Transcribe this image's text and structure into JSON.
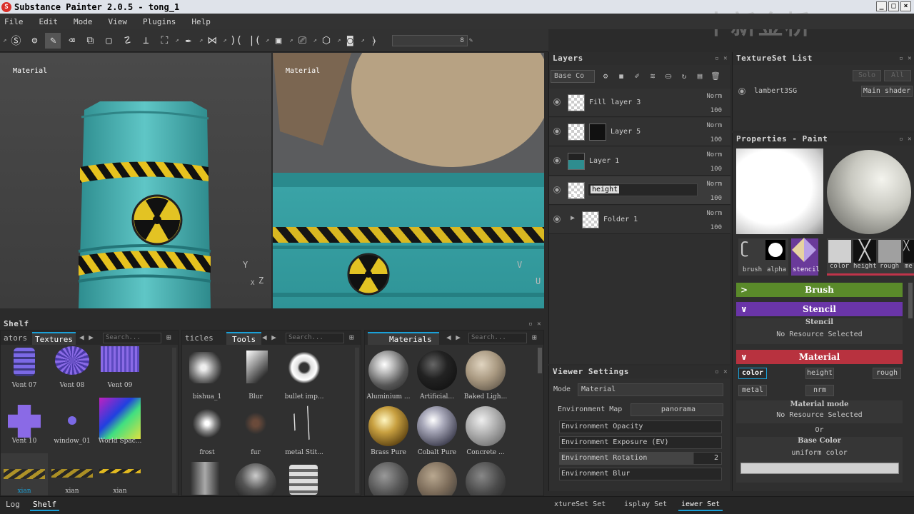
{
  "window": {
    "title": "Substance Painter 2.0.5 - tong_1",
    "app_icon": "S"
  },
  "menu": [
    "File",
    "Edit",
    "Mode",
    "View",
    "Plugins",
    "Help"
  ],
  "watermark": "中新金桥",
  "toolbar": {
    "size_value": "8"
  },
  "viewport_3d": {
    "label": "Material",
    "axis_y": "Y",
    "axis_z": "Z",
    "axis_x": "X"
  },
  "viewport_2d": {
    "label": "Material",
    "axis_v": "V",
    "axis_u": "U"
  },
  "layers": {
    "title": "Layers",
    "blend_mode": "Base Co",
    "items": [
      {
        "name": "Fill layer 3",
        "mode": "Norm",
        "opacity": "100"
      },
      {
        "name": "Layer 5",
        "mode": "Norm",
        "opacity": "100"
      },
      {
        "name": "Layer 1",
        "mode": "Norm",
        "opacity": "100"
      },
      {
        "name": "height",
        "mode": "Norm",
        "opacity": "100"
      },
      {
        "name": "Folder 1",
        "mode": "Norm",
        "opacity": "100"
      }
    ]
  },
  "viewer_settings": {
    "title": "Viewer Settings",
    "mode_label": "Mode",
    "mode_value": "Material",
    "env_map_label": "Environment Map",
    "env_map_value": "panorama",
    "env_opacity": "Environment Opacity",
    "env_exposure": "Environment Exposure (EV)",
    "env_rotation": "Environment Rotation",
    "env_rotation_value": "2",
    "env_blur": "Environment Blur"
  },
  "textureset": {
    "title": "TextureSet List",
    "solo": "Solo",
    "all": "All",
    "item_name": "lambert3SG",
    "shader": "Main shader"
  },
  "properties": {
    "title": "Properties - Paint",
    "brush_slots": [
      "brush",
      "alpha",
      "stencil"
    ],
    "mat_slots": [
      "color",
      "height",
      "rough",
      "me"
    ],
    "brush_section": "Brush",
    "stencil_section": "Stencil",
    "stencil_title": "Stencil",
    "stencil_res": "No Resource Selected",
    "material_section": "Material",
    "channels": [
      "color",
      "height",
      "rough",
      "metal",
      "nrm"
    ],
    "material_mode": "Material mode",
    "material_res": "No Resource Selected",
    "or": "Or",
    "base_color": "Base Color",
    "uniform_color": "uniform color"
  },
  "shelf": {
    "title": "Shelf",
    "panel1": {
      "tab_prev": "ators",
      "tab_active": "Textures",
      "search": "Search...",
      "items": [
        "Vent 07",
        "Vent 08",
        "Vent 09",
        "Vent 10",
        "window_01",
        "World Spac...",
        "xian",
        "xian",
        "xian"
      ]
    },
    "panel2": {
      "tab_prev": "ticles",
      "tab_active": "Tools",
      "search": "Search...",
      "items": [
        "bishua_1",
        "Blur",
        "bullet imp...",
        "frost",
        "fur",
        "metal Stit..."
      ]
    },
    "panel3": {
      "tab_active": "Materials",
      "search": "Search...",
      "items": [
        "Aluminium ...",
        "Artificial...",
        "Baked Ligh...",
        "Brass Pure",
        "Cobalt Pure",
        "Concrete ..."
      ]
    }
  },
  "bottom": {
    "left_tabs": [
      "Log",
      "Shelf"
    ],
    "right_tabs": [
      "xtureSet Set",
      "isplay Set",
      "iewer Set"
    ]
  }
}
